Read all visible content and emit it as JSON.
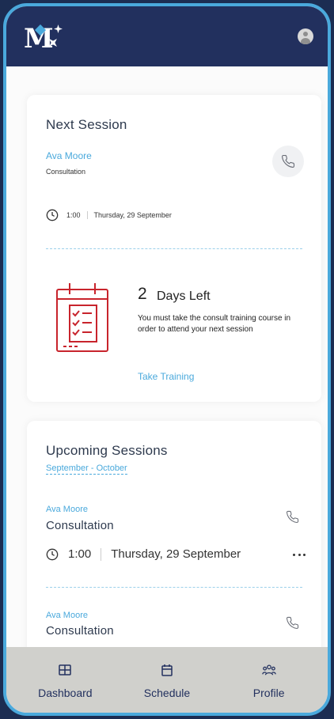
{
  "next_session": {
    "title": "Next Session",
    "name": "Ava Moore",
    "type": "Consultation",
    "time": "1:00",
    "date": "Thursday, 29 September",
    "days_number": "2",
    "days_label": "Days Left",
    "warning": "You must take the consult training course in order to attend your next session",
    "action": "Take Training"
  },
  "upcoming": {
    "title": "Upcoming Sessions",
    "range": "September - October",
    "sessions": [
      {
        "name": "Ava Moore",
        "type": "Consultation",
        "time": "1:00",
        "date": "Thursday, 29 September"
      },
      {
        "name": "Ava Moore",
        "type": "Consultation"
      }
    ]
  },
  "nav": [
    {
      "label": "Dashboard",
      "icon": "dashboard-icon"
    },
    {
      "label": "Schedule",
      "icon": "calendar-icon"
    },
    {
      "label": "Profile",
      "icon": "people-icon"
    }
  ],
  "colors": {
    "navy": "#22305e",
    "accent": "#4aa9dc",
    "alert_red": "#c8242c",
    "nav_bg": "#d0d0cc"
  }
}
